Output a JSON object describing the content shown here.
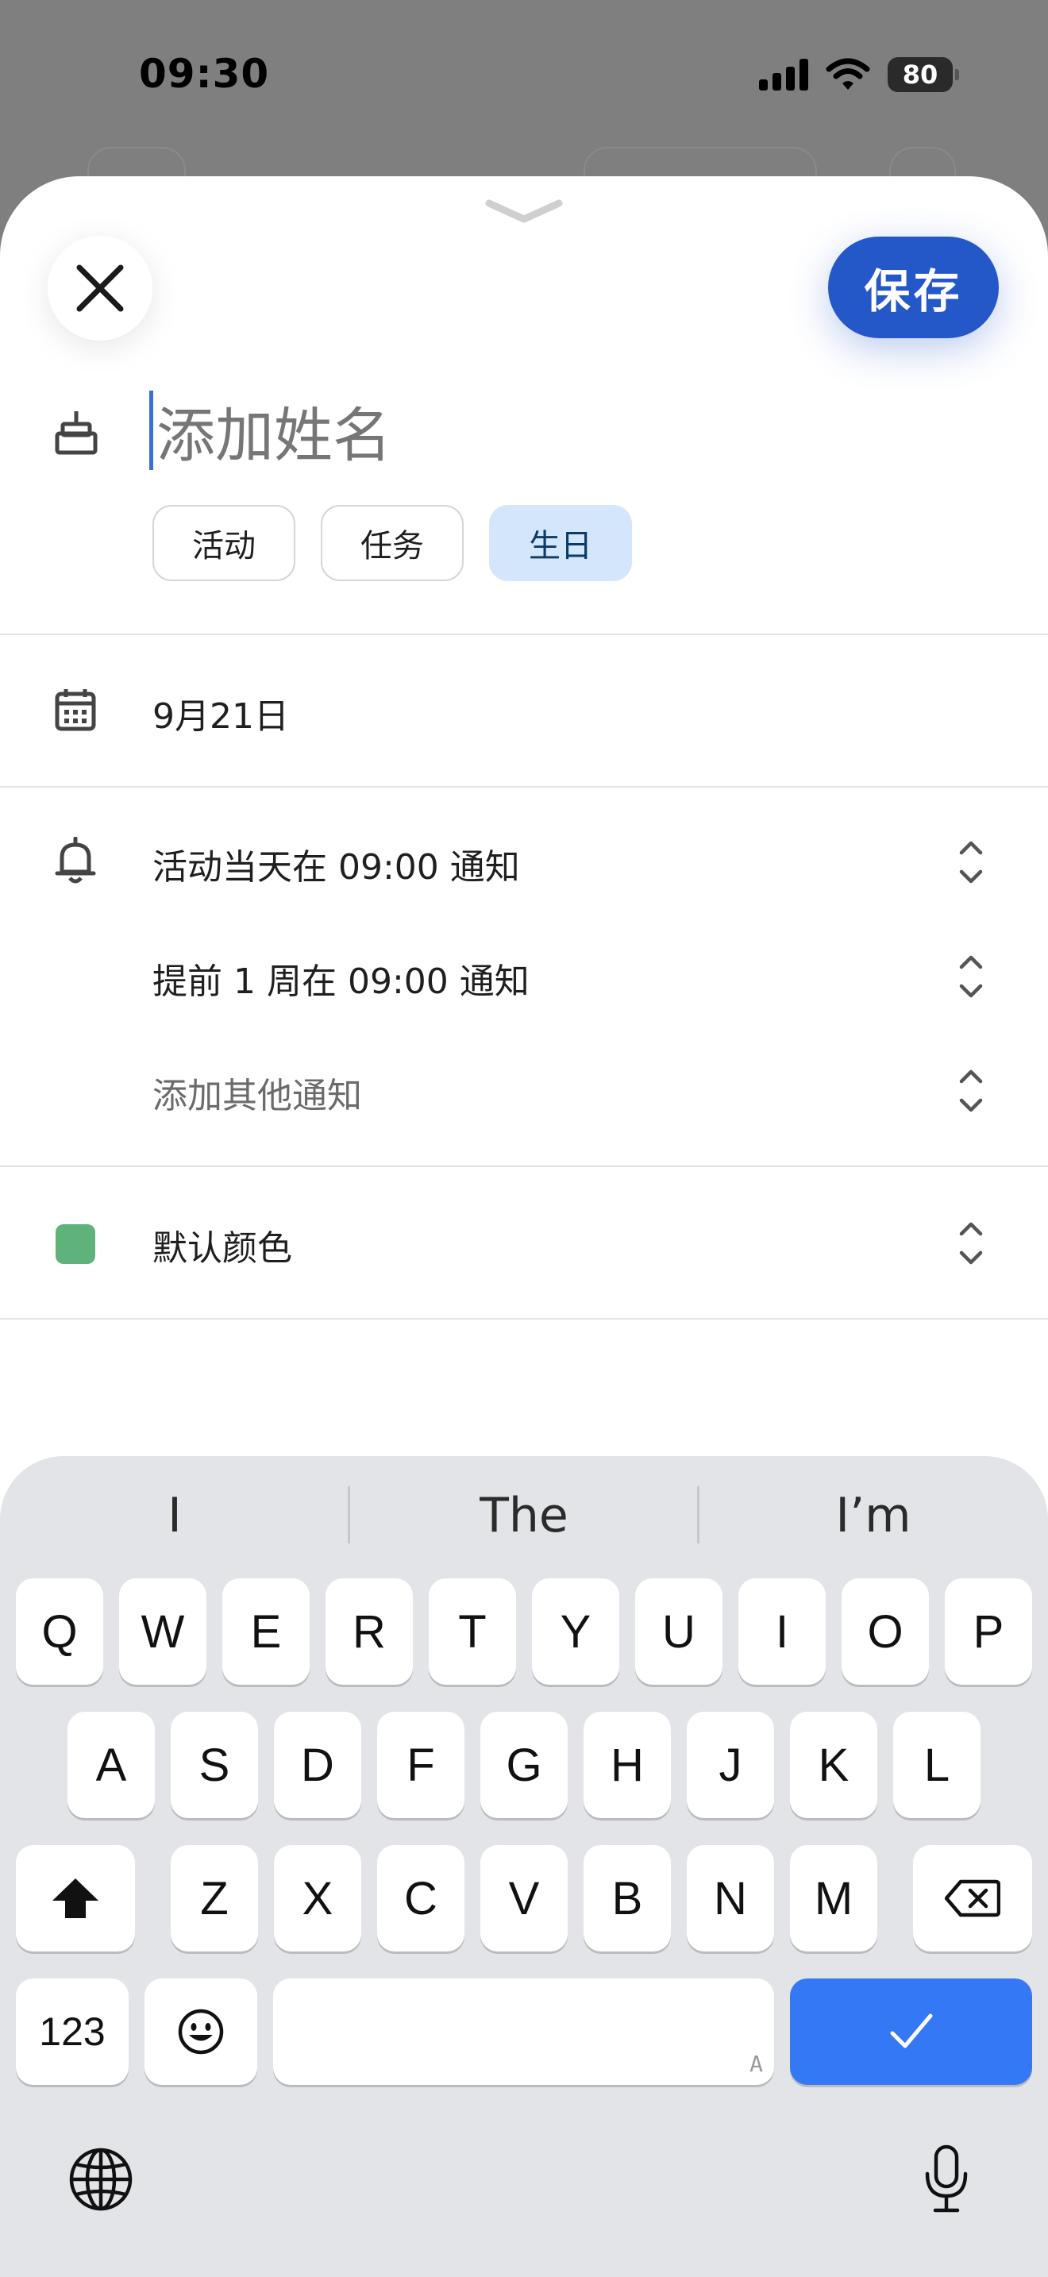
{
  "status_bar": {
    "time": "09:30",
    "battery": "80",
    "icons": [
      "signal-icon",
      "wifi-icon",
      "battery-icon"
    ]
  },
  "header": {
    "close_icon": "close-icon",
    "save_label": "保存"
  },
  "name_field": {
    "icon": "birthday-cake-icon",
    "placeholder": "添加姓名"
  },
  "type_chips": [
    {
      "label": "活动",
      "selected": false
    },
    {
      "label": "任务",
      "selected": false
    },
    {
      "label": "生日",
      "selected": true
    }
  ],
  "date_row": {
    "icon": "calendar-icon",
    "value": "9月21日"
  },
  "notifications": {
    "icon": "bell-icon",
    "items": [
      {
        "label": "活动当天在 09:00 通知"
      },
      {
        "label": "提前 1 周在 09:00 通知"
      },
      {
        "label": "添加其他通知"
      }
    ]
  },
  "color_row": {
    "label": "默认颜色",
    "swatch_color": "#5fb27a"
  },
  "keyboard": {
    "suggestions": [
      "I",
      "The",
      "I’m"
    ],
    "row1": [
      "Q",
      "W",
      "E",
      "R",
      "T",
      "Y",
      "U",
      "I",
      "O",
      "P"
    ],
    "row2": [
      "A",
      "S",
      "D",
      "F",
      "G",
      "H",
      "J",
      "K",
      "L"
    ],
    "row3": [
      "Z",
      "X",
      "C",
      "V",
      "B",
      "N",
      "M"
    ],
    "numbers_key": "123",
    "space_hint": "A",
    "accent_color": "#3478f6"
  }
}
